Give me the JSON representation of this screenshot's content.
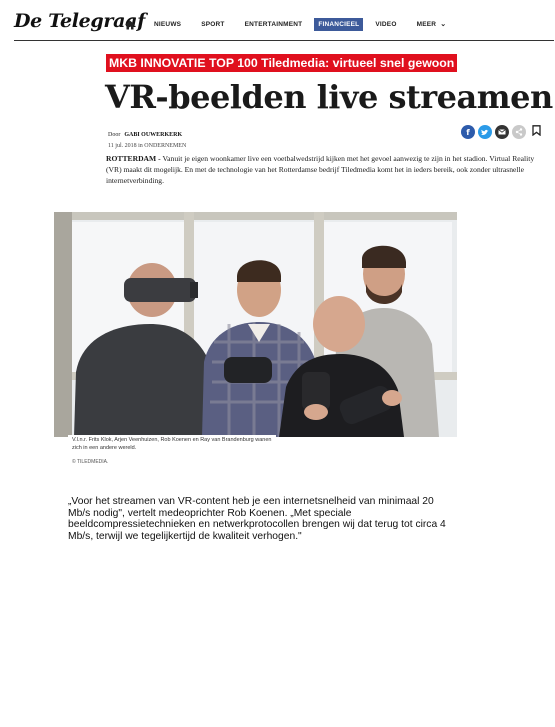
{
  "header": {
    "logo": "De Telegraaf",
    "nav": [
      {
        "label": "NIEUWS",
        "active": false
      },
      {
        "label": "SPORT",
        "active": false
      },
      {
        "label": "ENTERTAINMENT",
        "active": false
      },
      {
        "label": "FINANCIEEL",
        "active": true
      },
      {
        "label": "VIDEO",
        "active": false
      },
      {
        "label": "MEER",
        "active": false
      }
    ]
  },
  "article": {
    "kicker": "MKB INNOVATIE TOP 100 Tiledmedia: virtueel snel gewoon",
    "headline": "VR-beelden live streamen",
    "byline_prefix": "Door",
    "author": "GABI OUWERKERK",
    "date": "11 jul. 2018 in ONDERNEMEN",
    "lede_place": "ROTTERDAM - ",
    "lede_text": "Vanuit je eigen woonkamer live een voetbalwedstrijd kijken met het gevoel aanwezig te zijn in het stadion. Virtual Reality (VR) maakt dit mogelijk. En met de technologie van het Rotterdamse bedrijf Tiledmedia komt het in ieders bereik, ook zonder ultrasnelle internetverbinding.",
    "caption": "V.l.n.r. Frits Klok, Arjen Veenhuizen, Rob Koenen en Ray van Brandenburg wanen zich in een andere wereld.",
    "credit": "© TILEDMEDIA.",
    "quote": "„Voor het streamen van VR-content heb je een internetsnelheid van minimaal 20 Mb/s nodig\", vertelt medeoprichter Rob Koenen. „Met speciale beeldcompressietechnieken en netwerkprotocollen brengen wij dat terug tot circa 4 Mb/s, terwijl we tegelijkertijd de kwaliteit verhogen.\""
  },
  "colors": {
    "kicker_bg": "#e0101e",
    "nav_active_bg": "#3d5a9a",
    "facebook": "#2d5bab",
    "twitter": "#2b9be8",
    "mail": "#333333",
    "share": "#c9c9c9"
  },
  "icons": {
    "home": "home-icon",
    "facebook": "facebook-icon",
    "twitter": "twitter-icon",
    "mail": "mail-icon",
    "share": "share-icon",
    "bookmark": "bookmark-icon"
  }
}
